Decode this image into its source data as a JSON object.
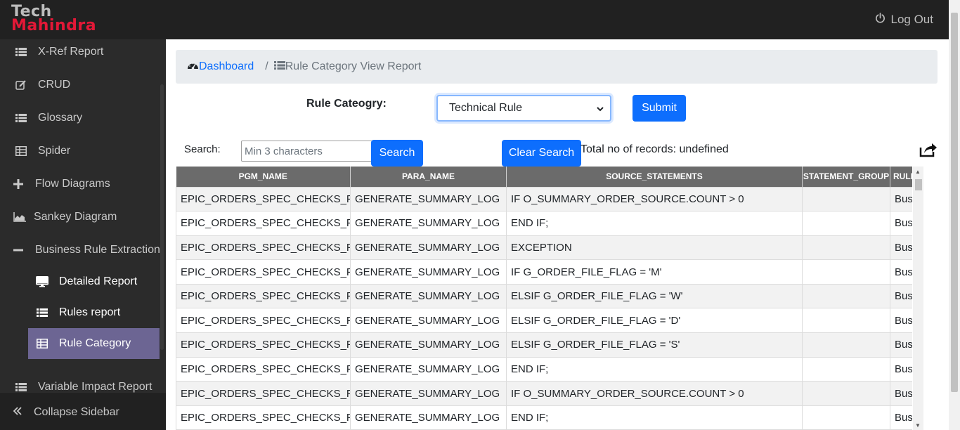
{
  "header": {
    "logo_line1": "Tech",
    "logo_line2": "Mahindra",
    "logout_label": "Log Out",
    "logout_icon": "power-icon"
  },
  "sidebar": {
    "items": [
      {
        "label": "X-Ref Report",
        "icon": "list-icon"
      },
      {
        "label": "CRUD",
        "icon": "edit-icon"
      },
      {
        "label": "Glossary",
        "icon": "list-icon"
      },
      {
        "label": "Spider",
        "icon": "table-icon"
      },
      {
        "label": "Flow Diagrams",
        "icon": "plus-icon"
      },
      {
        "label": "Sankey Diagram",
        "icon": "area-chart-icon"
      },
      {
        "label": "Business Rule Extraction",
        "icon": "minus-icon"
      },
      {
        "label": "Detailed Report",
        "icon": "desktop-icon"
      },
      {
        "label": "Rules report",
        "icon": "list-icon"
      },
      {
        "label": "Rule Category",
        "icon": "table-icon"
      },
      {
        "label": "Variable Impact Report",
        "icon": "list-icon"
      }
    ],
    "collapse_label": "Collapse Sidebar",
    "collapse_icon": "double-chevron-left-icon"
  },
  "breadcrumb": {
    "home_label": "Dashboard",
    "separator": "/",
    "current_label": "Rule Category View Report"
  },
  "filter": {
    "category_label": "Rule Cateogry:",
    "category_value": "Technical Rule",
    "submit_label": "Submit",
    "search_label": "Search:",
    "search_placeholder": "Min 3 characters",
    "search_button": "Search",
    "clear_button": "Clear Search",
    "total_records": "Total no of records: undefined"
  },
  "table": {
    "columns": [
      "PGM_NAME",
      "PARA_NAME",
      "SOURCE_STATEMENTS",
      "STATEMENT_GROUP",
      "RULE"
    ],
    "column_header_visible": [
      "PGM_NAME",
      "PARA_NAME",
      "SOURCE_STATEMENTS",
      "STATEMENT_GROUP",
      "RULI"
    ],
    "rows": [
      [
        "EPIC_ORDERS_SPEC_CHECKS_PKG",
        "GENERATE_SUMMARY_LOG",
        "IF O_SUMMARY_ORDER_SOURCE.COUNT > 0",
        "",
        "Bus"
      ],
      [
        "EPIC_ORDERS_SPEC_CHECKS_PKG",
        "GENERATE_SUMMARY_LOG",
        "END IF;",
        "",
        "Bus"
      ],
      [
        "EPIC_ORDERS_SPEC_CHECKS_PKG",
        "GENERATE_SUMMARY_LOG",
        "EXCEPTION",
        "",
        "Bus"
      ],
      [
        "EPIC_ORDERS_SPEC_CHECKS_PKG",
        "GENERATE_SUMMARY_LOG",
        "IF G_ORDER_FILE_FLAG = 'M'",
        "",
        "Bus"
      ],
      [
        "EPIC_ORDERS_SPEC_CHECKS_PKG",
        "GENERATE_SUMMARY_LOG",
        "ELSIF G_ORDER_FILE_FLAG = 'W'",
        "",
        "Bus"
      ],
      [
        "EPIC_ORDERS_SPEC_CHECKS_PKG",
        "GENERATE_SUMMARY_LOG",
        "ELSIF G_ORDER_FILE_FLAG = 'D'",
        "",
        "Bus"
      ],
      [
        "EPIC_ORDERS_SPEC_CHECKS_PKG",
        "GENERATE_SUMMARY_LOG",
        "ELSIF G_ORDER_FILE_FLAG = 'S'",
        "",
        "Bus"
      ],
      [
        "EPIC_ORDERS_SPEC_CHECKS_PKG",
        "GENERATE_SUMMARY_LOG",
        "END IF;",
        "",
        "Bus"
      ],
      [
        "EPIC_ORDERS_SPEC_CHECKS_PKG",
        "GENERATE_SUMMARY_LOG",
        "IF O_SUMMARY_ORDER_SOURCE.COUNT > 0",
        "",
        "Bus"
      ],
      [
        "EPIC_ORDERS_SPEC_CHECKS_PKG",
        "GENERATE_SUMMARY_LOG",
        "END IF;",
        "",
        "Bus"
      ]
    ]
  },
  "colors": {
    "header_bg": "#212121",
    "sidebar_bg": "#2b2b2b",
    "active_item_bg": "#6c6593",
    "primary": "#0d6efd",
    "logo_red": "#e31837",
    "table_header_bg": "#6b6b6b"
  }
}
